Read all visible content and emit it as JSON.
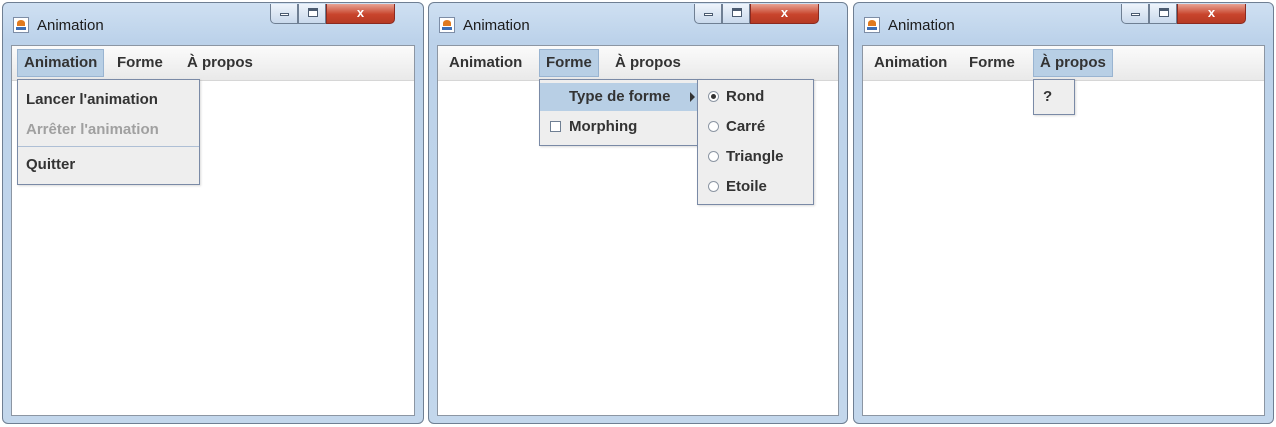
{
  "windows": [
    {
      "title": "Animation",
      "menus": [
        "Animation",
        "Forme",
        "À propos"
      ],
      "open_menu": "Animation",
      "popup_items": [
        "Lancer l'animation",
        "Arrêter l'animation",
        "Quitter"
      ]
    },
    {
      "title": "Animation",
      "menus": [
        "Animation",
        "Forme",
        "À propos"
      ],
      "open_menu": "Forme",
      "popup_items": [
        "Type de forme",
        "Morphing"
      ],
      "submenu_items": [
        "Rond",
        "Carré",
        "Triangle",
        "Etoile"
      ],
      "submenu_selected": "Rond"
    },
    {
      "title": "Animation",
      "menus": [
        "Animation",
        "Forme",
        "À propos"
      ],
      "open_menu": "À propos",
      "popup_items": [
        "?"
      ]
    }
  ],
  "window_controls": {
    "minimize_glyph": "minimize-icon",
    "maximize_glyph": "maximize-icon",
    "close_glyph": "x"
  },
  "colors": {
    "menu_highlight": "#b8cfe5",
    "close_button": "#c8442c",
    "disabled_text": "#a0a0a0"
  }
}
